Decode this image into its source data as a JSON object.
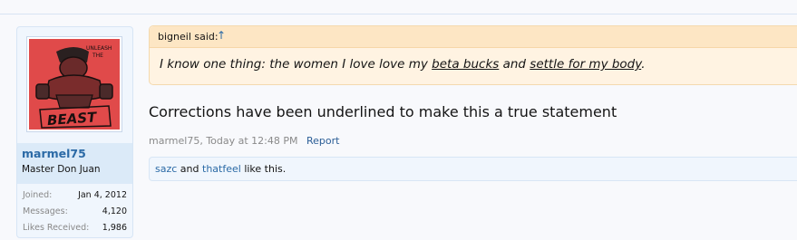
{
  "user": {
    "username": "marmel75",
    "title": "Master Don Juan",
    "stats": [
      {
        "label": "Joined:",
        "value": "Jan 4, 2012"
      },
      {
        "label": "Messages:",
        "value": "4,120"
      },
      {
        "label": "Likes Received:",
        "value": "1,986"
      }
    ],
    "avatar": {
      "icon": "beast-cartoon-avatar",
      "background": "#e04a4a"
    }
  },
  "quote": {
    "author": "bigneil said:",
    "arrow": "↑",
    "parts": [
      {
        "text": "I know one thing: the women I love love my ",
        "underline": false
      },
      {
        "text": "beta bucks",
        "underline": true
      },
      {
        "text": " and ",
        "underline": false
      },
      {
        "text": "settle for my body",
        "underline": true
      },
      {
        "text": ".",
        "underline": false
      }
    ]
  },
  "message": "Corrections have been underlined to make this a true statement",
  "meta": {
    "author_date": "marmel75, Today at 12:48 PM",
    "report": "Report"
  },
  "likes": {
    "user1": "sazc",
    "joiner": "and",
    "user2": "thatfeel",
    "suffix": "like this."
  },
  "colors": {
    "link": "#2b6aa6",
    "quote_bg": "#fff3e2",
    "panel_bg": "#f0f6fd"
  }
}
